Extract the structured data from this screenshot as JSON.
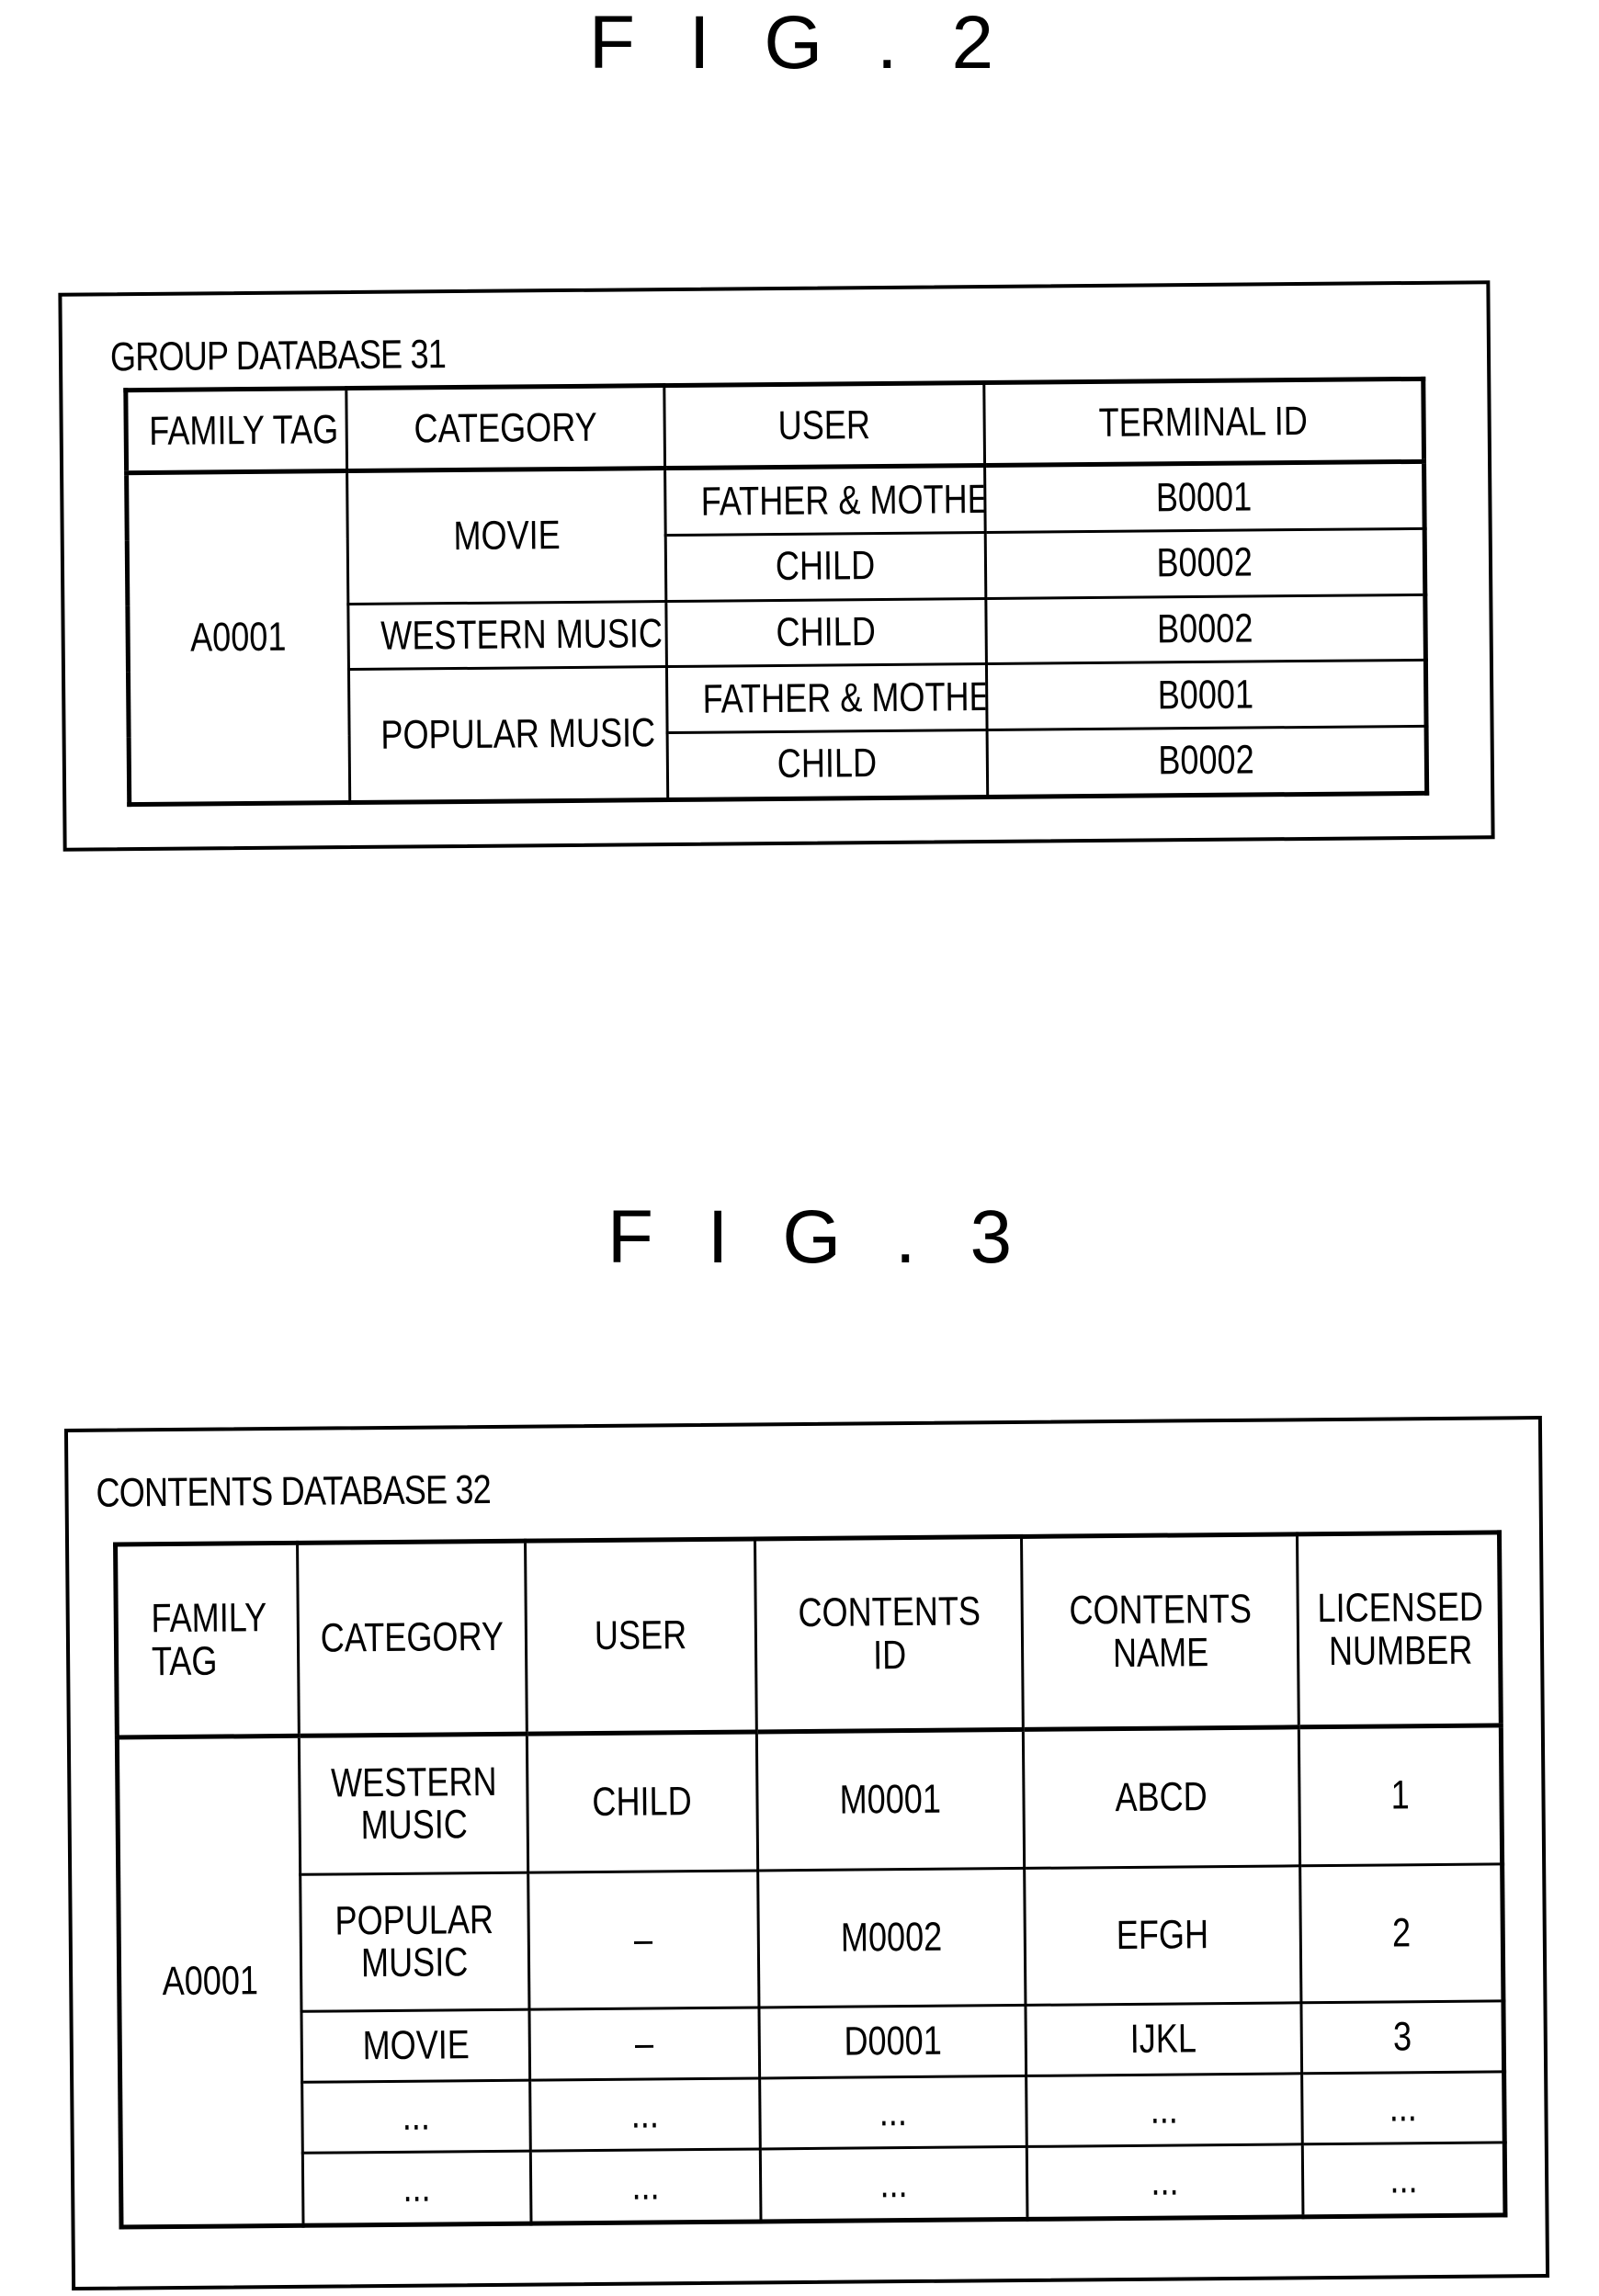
{
  "fig2": {
    "title": "F I G . 2",
    "database_title": "GROUP DATABASE 31",
    "columns": [
      "FAMILY TAG",
      "CATEGORY",
      "USER",
      "TERMINAL ID"
    ],
    "family_tag": "A0001",
    "groups": [
      {
        "category": "MOVIE",
        "rows": [
          {
            "user": "FATHER & MOTHER",
            "terminal_id": "B0001"
          },
          {
            "user": "CHILD",
            "terminal_id": "B0002"
          }
        ]
      },
      {
        "category": "WESTERN MUSIC",
        "rows": [
          {
            "user": "CHILD",
            "terminal_id": "B0002"
          }
        ]
      },
      {
        "category": "POPULAR MUSIC",
        "rows": [
          {
            "user": "FATHER & MOTHER",
            "terminal_id": "B0001"
          },
          {
            "user": "CHILD",
            "terminal_id": "B0002"
          }
        ]
      }
    ]
  },
  "fig3": {
    "title": "F I G . 3",
    "database_title": "CONTENTS DATABASE 32",
    "columns": [
      [
        "FAMILY",
        "TAG"
      ],
      [
        "CATEGORY"
      ],
      [
        "USER"
      ],
      [
        "CONTENTS",
        "ID"
      ],
      [
        "CONTENTS",
        "NAME"
      ],
      [
        "LICENSED",
        "NUMBER"
      ]
    ],
    "family_tag": "A0001",
    "rows": [
      {
        "category": [
          "WESTERN",
          "MUSIC"
        ],
        "user": "CHILD",
        "contents_id": "M0001",
        "contents_name": "ABCD",
        "licensed_number": "1"
      },
      {
        "category": [
          "POPULAR",
          "MUSIC"
        ],
        "user": "–",
        "contents_id": "M0002",
        "contents_name": "EFGH",
        "licensed_number": "2"
      },
      {
        "category": [
          "MOVIE"
        ],
        "user": "–",
        "contents_id": "D0001",
        "contents_name": "IJKL",
        "licensed_number": "3"
      },
      {
        "category": [
          "..."
        ],
        "user": "...",
        "contents_id": "...",
        "contents_name": "...",
        "licensed_number": "..."
      },
      {
        "category": [
          "..."
        ],
        "user": "...",
        "contents_id": "...",
        "contents_name": "...",
        "licensed_number": "..."
      }
    ]
  }
}
